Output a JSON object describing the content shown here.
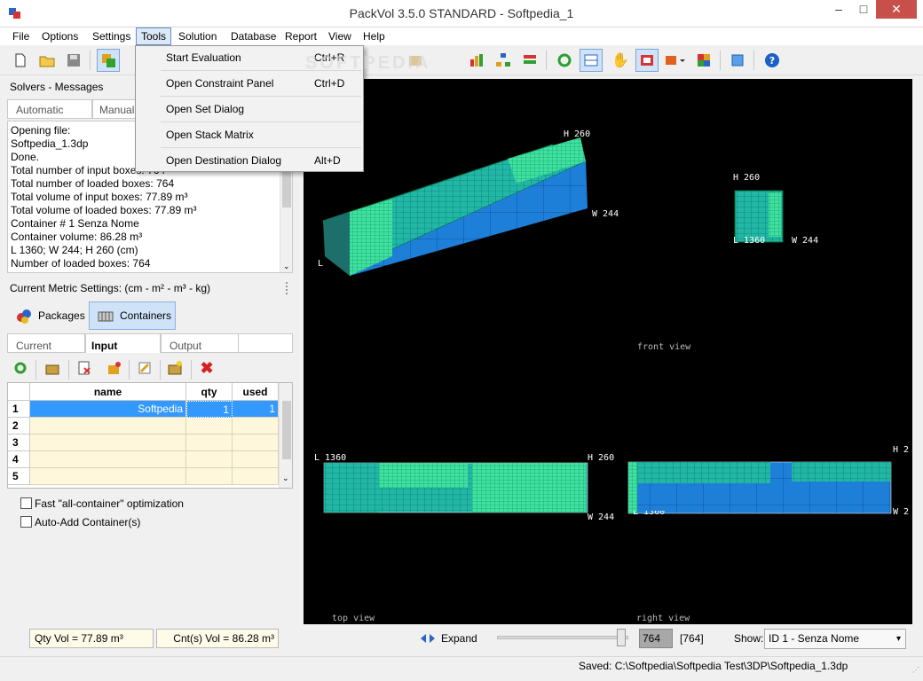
{
  "window": {
    "title": "PackVol 3.5.0 STANDARD - Softpedia_1",
    "minimize": "–",
    "maximize": "□",
    "close": "✕"
  },
  "menubar": [
    "File",
    "Options",
    "Settings",
    "Tools",
    "Solution",
    "Database",
    "Report",
    "View",
    "Help"
  ],
  "tools_menu": [
    {
      "label": "Start Evaluation",
      "shortcut": "Ctrl+R"
    },
    {
      "label": "Open Constraint Panel",
      "shortcut": "Ctrl+D"
    },
    {
      "label": "Open Set Dialog",
      "shortcut": ""
    },
    {
      "label": "Open Stack Matrix",
      "shortcut": ""
    },
    {
      "label": "Open Destination Dialog",
      "shortcut": "Alt+D"
    }
  ],
  "watermark": "SOFTPEDIA",
  "solvers": {
    "title": "Solvers - Messages",
    "tabs": [
      "Automatic",
      "Manual"
    ],
    "messages": [
      "Opening file:",
      "Softpedia_1.3dp",
      "Done.",
      "Total number of input boxes: 764",
      "Total number of loaded boxes:  764",
      "Total volume of input boxes: 77.89 m³",
      "Total volume of loaded boxes: 77.89 m³",
      "Container # 1 Senza Nome",
      "Container volume: 86.28 m³",
      "L 1360; W 244; H 260 (cm)",
      "Number of loaded boxes: 764"
    ]
  },
  "metric": {
    "label": "Current Metric Settings: (cm - m² - m³ - kg)",
    "packages": "Packages",
    "containers": "Containers"
  },
  "subtabs": [
    "Current",
    "Input",
    "Output"
  ],
  "grid": {
    "headers": [
      "name",
      "qty",
      "used"
    ],
    "rows": [
      {
        "num": "1",
        "name": "Softpedia",
        "qty": "1",
        "used": "1"
      },
      {
        "num": "2",
        "name": "",
        "qty": "",
        "used": ""
      },
      {
        "num": "3",
        "name": "",
        "qty": "",
        "used": ""
      },
      {
        "num": "4",
        "name": "",
        "qty": "",
        "used": ""
      },
      {
        "num": "5",
        "name": "",
        "qty": "",
        "used": ""
      }
    ]
  },
  "options": {
    "fast": "Fast \"all-container\" optimization",
    "auto": "Auto-Add Container(s)"
  },
  "summary": {
    "qty_vol": "Qty Vol = 77.89 m³",
    "cnt_vol": "Cnt(s) Vol = 86.28 m³"
  },
  "views": {
    "front": "front view",
    "top": "top view",
    "right": "right view",
    "h260": "H 260",
    "w244": "W 244",
    "l": "L",
    "l1360": "L 1360",
    "l1360b": "L 1360",
    "l_partial": "L 1360",
    "h_partial": "H 2",
    "w_partial": "W 2"
  },
  "controls": {
    "expand": "Expand",
    "boxes": "764",
    "boxes_bracket": "[764]",
    "show_label": "Show:",
    "show_value": "ID 1 - Senza Nome"
  },
  "status": "Saved: C:\\Softpedia\\Softpedia Test\\3DP\\Softpedia_1.3dp",
  "colors": {
    "container_blue": "#1e7fd8",
    "box_teal": "#22b7a5",
    "box_mint": "#3fe0a0",
    "viewport_bg": "#000000"
  }
}
